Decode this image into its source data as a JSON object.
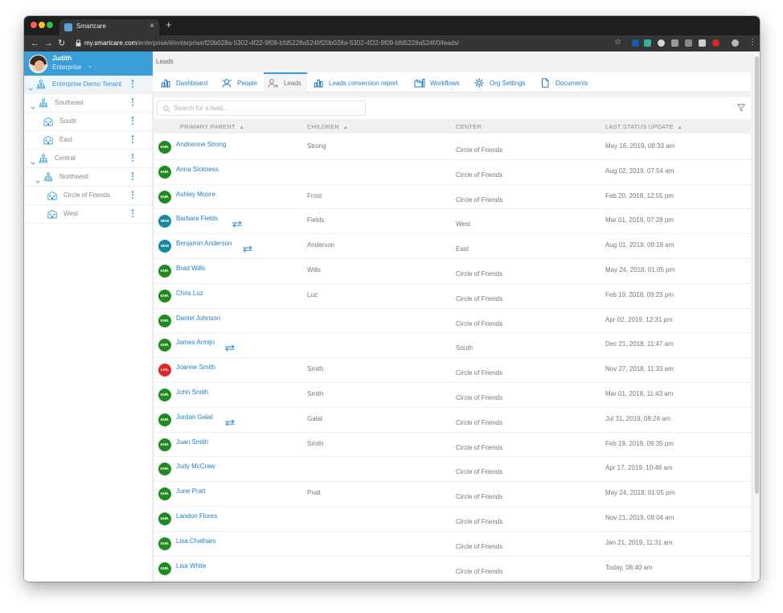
{
  "browser": {
    "tab_title": "Smartcare",
    "tab_close": "×",
    "new_tab": "+",
    "url_host": "my.smartcare.com",
    "url_path": "/enterprise/#/enterprise/f20b028a-5302-4f22-9f09-bfd5228a524f/f20b028a-5302-4f22-9f09-bfd5228a524f/0/leads/"
  },
  "user": {
    "name": "Judith",
    "role": "Enterprise"
  },
  "tree": [
    {
      "label": "Enterprise Demo Tenant",
      "level": 0,
      "expandable": true,
      "icon": "org",
      "selected": true
    },
    {
      "label": "Southeast",
      "level": 1,
      "expandable": true,
      "icon": "org"
    },
    {
      "label": "South",
      "level": 2,
      "expandable": false,
      "icon": "building"
    },
    {
      "label": "East",
      "level": 2,
      "expandable": false,
      "icon": "building"
    },
    {
      "label": "Central",
      "level": 1,
      "expandable": true,
      "icon": "org"
    },
    {
      "label": "Northwest",
      "level": 2,
      "expandable": true,
      "icon": "org"
    },
    {
      "label": "Circle of Friends",
      "level": 3,
      "expandable": false,
      "icon": "building"
    },
    {
      "label": "West",
      "level": 3,
      "expandable": false,
      "icon": "building"
    }
  ],
  "breadcrumb": "Leads",
  "nav": [
    {
      "label": "Dashboard",
      "icon": "dashboard"
    },
    {
      "label": "People",
      "icon": "people"
    },
    {
      "label": "Leads",
      "icon": "leads",
      "active": true
    },
    {
      "label": "Leads conversion report",
      "icon": "report"
    },
    {
      "label": "Workflows",
      "icon": "workflow"
    },
    {
      "label": "Org Settings",
      "icon": "gear"
    },
    {
      "label": "Documents",
      "icon": "document"
    }
  ],
  "search": {
    "placeholder": "Search for a lead..."
  },
  "table": {
    "columns": [
      "PRIMARY PARENT",
      "CHILDREN",
      "CENTER",
      "LAST STATUS UPDATE"
    ],
    "rows": [
      {
        "status": "ENR.",
        "name": "Andrienne Strong",
        "transfer": false,
        "child": "Strong",
        "center": "Circle of Friends",
        "updated": "May 16, 2019, 08:33 am"
      },
      {
        "status": "ENR.",
        "name": "Anna Sickness",
        "transfer": false,
        "child": "",
        "center": "Circle of Friends",
        "updated": "Aug 02, 2019, 07:54 am"
      },
      {
        "status": "ENR.",
        "name": "Ashley Moore",
        "transfer": false,
        "child": "Frost",
        "center": "Circle of Friends",
        "updated": "Feb 20, 2018, 12:55 pm"
      },
      {
        "status": "NEW",
        "name": "Barbara Fields",
        "transfer": true,
        "child": "Fields",
        "center": "West",
        "updated": "Mar 01, 2019, 07:28 pm"
      },
      {
        "status": "NEW",
        "name": "Benjamin Anderson",
        "transfer": true,
        "child": "Anderson",
        "center": "East",
        "updated": "Aug 01, 2019, 09:18 am"
      },
      {
        "status": "ENR.",
        "name": "Brad Wills",
        "transfer": false,
        "child": "Wills",
        "center": "Circle of Friends",
        "updated": "May 24, 2018, 01:05 pm"
      },
      {
        "status": "ENR.",
        "name": "Chris Luz",
        "transfer": false,
        "child": "Luz",
        "center": "Circle of Friends",
        "updated": "Feb 19, 2018, 09:23 pm"
      },
      {
        "status": "ENR.",
        "name": "Daniel Johnson",
        "transfer": false,
        "child": "",
        "center": "Circle of Friends",
        "updated": "Apr 02, 2019, 12:31 pm"
      },
      {
        "status": "ENR.",
        "name": "James Armijo",
        "transfer": true,
        "child": "",
        "center": "South",
        "updated": "Dec 21, 2018, 11:47 am"
      },
      {
        "status": "LOS.",
        "name": "Joanne Smith",
        "transfer": false,
        "child": "Smith",
        "center": "Circle of Friends",
        "updated": "Nov 27, 2018, 11:33 am"
      },
      {
        "status": "ENR.",
        "name": "John Smith",
        "transfer": false,
        "child": "Smith",
        "center": "Circle of Friends",
        "updated": "Mar 01, 2018, 11:43 am"
      },
      {
        "status": "ENR.",
        "name": "Jordan Galat",
        "transfer": true,
        "child": "Galat",
        "center": "Circle of Friends",
        "updated": "Jul 31, 2019, 09:26 am"
      },
      {
        "status": "ENR.",
        "name": "Juan Smith",
        "transfer": false,
        "child": "Smith",
        "center": "Circle of Friends",
        "updated": "Feb 19, 2019, 09:35 pm"
      },
      {
        "status": "ENR.",
        "name": "Judy McCraw",
        "transfer": false,
        "child": "",
        "center": "Circle of Friends",
        "updated": "Apr 17, 2019, 10:46 am"
      },
      {
        "status": "ENR.",
        "name": "June Pratt",
        "transfer": false,
        "child": "Pratt",
        "center": "Circle of Friends",
        "updated": "May 24, 2018, 01:05 pm"
      },
      {
        "status": "ENR.",
        "name": "Landon Flores",
        "transfer": false,
        "child": "",
        "center": "Circle of Friends",
        "updated": "Nov 21, 2019, 08:04 am"
      },
      {
        "status": "ENR.",
        "name": "Lisa Chatham",
        "transfer": false,
        "child": "",
        "center": "Circle of Friends",
        "updated": "Jan 21, 2019, 11:31 am"
      },
      {
        "status": "ENR.",
        "name": "Lisa White",
        "transfer": false,
        "child": "",
        "center": "Circle of Friends",
        "updated": "Today, 08:40 am"
      }
    ]
  },
  "colors": {
    "accent": "#3a9fd9",
    "link": "#1f7fc4",
    "status_enrolled": "#1f8a1f",
    "status_new": "#168a9a",
    "status_lost": "#e0262a"
  }
}
